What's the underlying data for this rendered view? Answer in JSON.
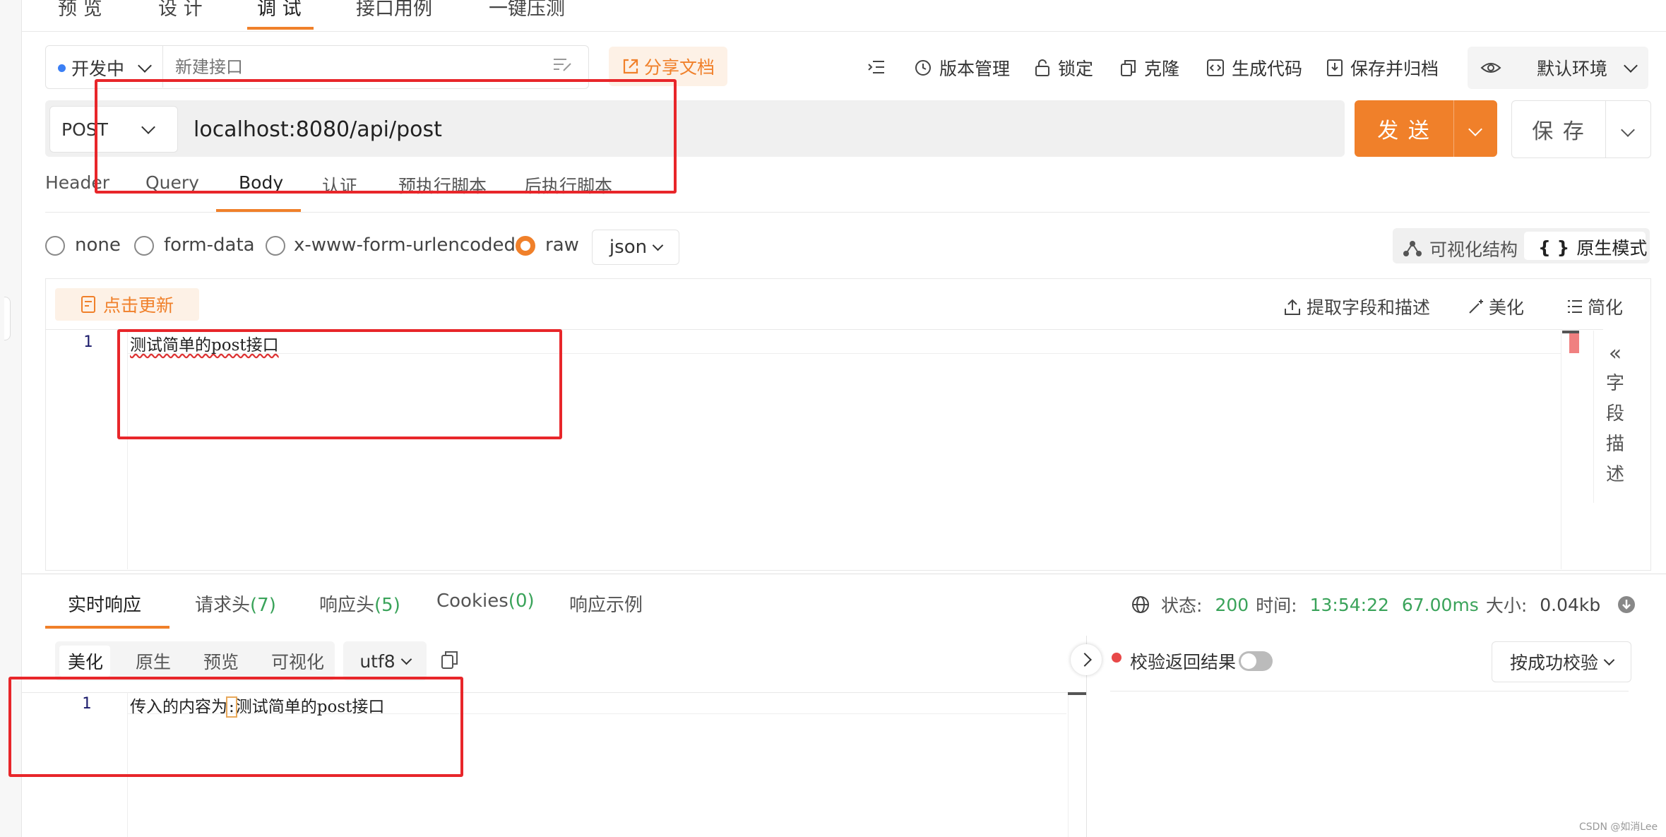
{
  "top_tabs": [
    "预 览",
    "设 计",
    "调 试",
    "接口用例",
    "一键压测"
  ],
  "status": {
    "label": "开发中"
  },
  "api_name": {
    "placeholder": "新建接口"
  },
  "share_label": "分享文档",
  "toolbar": {
    "version": "版本管理",
    "lock": "锁定",
    "clone": "克隆",
    "gen_code": "生成代码",
    "save_archive": "保存并归档"
  },
  "environment": "默认环境",
  "request": {
    "method": "POST",
    "url": "localhost:8080/api/post",
    "send_label": "发 送",
    "save_label": "保 存"
  },
  "req_tabs": [
    "Header",
    "Query",
    "Body",
    "认证",
    "预执行脚本",
    "后执行脚本"
  ],
  "body_types": [
    "none",
    "form-data",
    "x-www-form-urlencoded",
    "raw"
  ],
  "format_select": "json",
  "modes": {
    "visual": "可视化结构",
    "raw": "原生模式"
  },
  "editor_actions": {
    "update": "点击更新",
    "extract": "提取字段和描述",
    "beautify": "美化",
    "simplify": "简化"
  },
  "editor": {
    "line": "1",
    "content": "测试简单的post接口"
  },
  "field_desc": [
    "字",
    "段",
    "描",
    "述"
  ],
  "resp_tabs": {
    "realtime": "实时响应",
    "req_headers": "请求头",
    "req_headers_count": "(7)",
    "resp_headers": "响应头",
    "resp_headers_count": "(5)",
    "cookies": "Cookies",
    "cookies_count": "(0)",
    "example": "响应示例"
  },
  "resp_meta": {
    "status_label": "状态:",
    "status_value": "200",
    "time_label": "时间:",
    "time_value": "13:54:22",
    "duration": "67.00ms",
    "size_label": "大小:",
    "size_value": "0.04kb"
  },
  "resp_formats": [
    "美化",
    "原生",
    "预览",
    "可视化"
  ],
  "encoding": "utf8",
  "validate_label": "校验返回结果",
  "validate_mode": "按成功校验",
  "response": {
    "line": "1",
    "prefix": "传入的内容为",
    "colon": ":",
    "content": "测试简单的post接口"
  },
  "watermark": "CSDN @如消Lee",
  "colors": {
    "accent": "#f0802a",
    "success": "#3aa35a",
    "annotation": "#e8262a"
  }
}
